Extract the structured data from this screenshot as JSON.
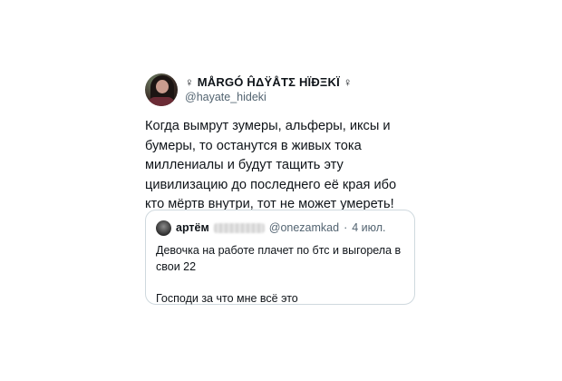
{
  "tweet": {
    "display_name": "♀ MÅRGÓ ĤΔŸÅTΣ HÏÐΞKÏ ♀",
    "handle": "@hayate_hideki",
    "text": "Когда вымрут зумеры, альферы, иксы и бумеры, то останутся в живых тока миллениалы и будут тащить эту цивилизацию до последнего её края ибо кто мёртв внутри, тот не может умереть!"
  },
  "quote": {
    "display_name": "артём",
    "handle": "@onezamkad",
    "separator": "·",
    "date": "4 июл.",
    "text": "Девочка на работе плачет по бтс и выгорела в свои 22\n\nГосподи за что мне всё это"
  },
  "icons": {
    "avatar": "user-avatar-image",
    "quote_avatar": "quoted-user-avatar-image"
  }
}
